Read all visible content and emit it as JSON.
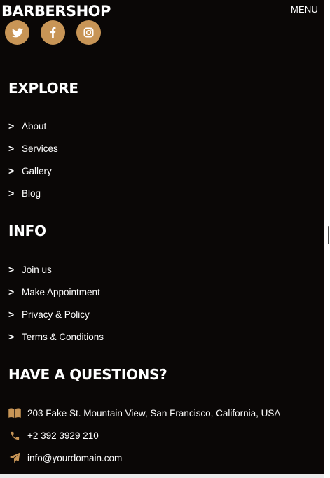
{
  "brand": "BARBERSHOP",
  "menu_label": "MENU",
  "social": [
    {
      "icon": "twitter-icon"
    },
    {
      "icon": "facebook-icon"
    },
    {
      "icon": "instagram-icon"
    }
  ],
  "explore": {
    "title": "EXPLORE",
    "links": [
      "About",
      "Services",
      "Gallery",
      "Blog"
    ]
  },
  "info": {
    "title": "INFO",
    "links": [
      "Join us",
      "Make Appointment",
      "Privacy & Policy",
      "Terms & Conditions"
    ]
  },
  "contact": {
    "title": "HAVE A QUESTIONS?",
    "address": "203 Fake St. Mountain View, San Francisco, California, USA",
    "phone": "+2 392 3929 210",
    "email": "info@yourdomain.com"
  },
  "colors": {
    "background": "#0a0706",
    "accent": "#c89556",
    "text": "#ffffff"
  }
}
